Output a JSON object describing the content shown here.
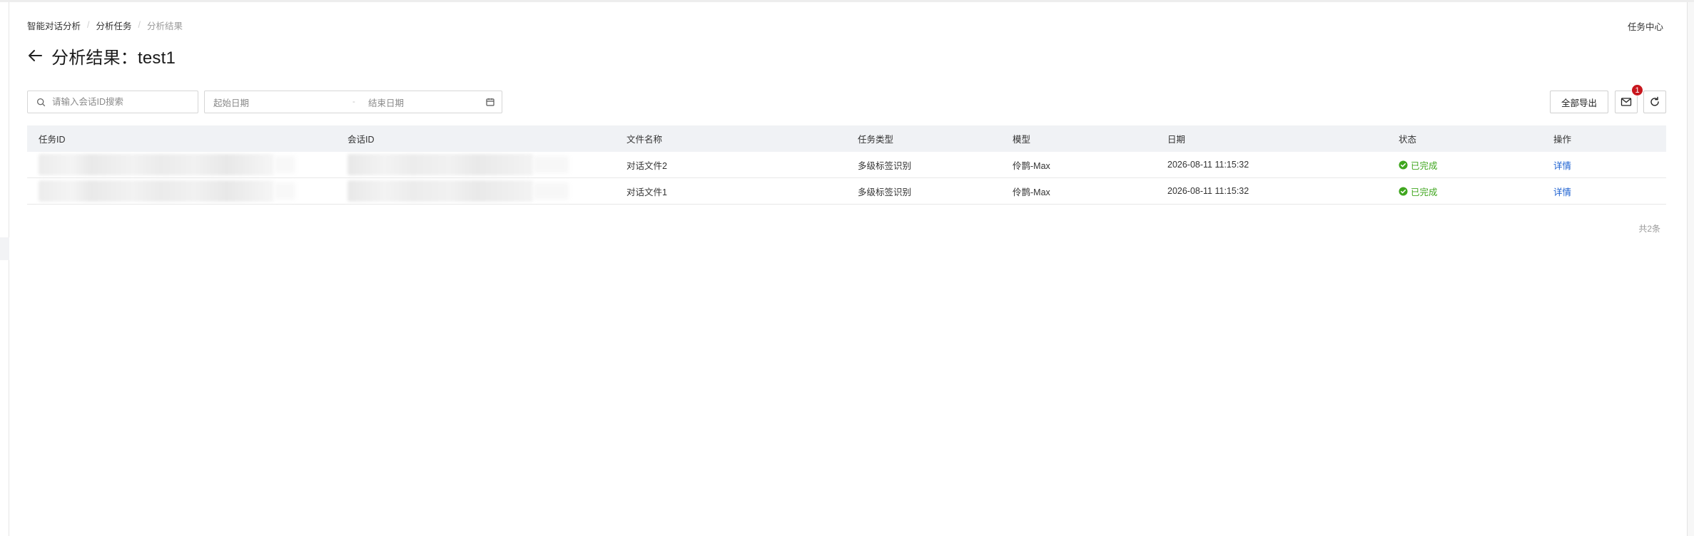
{
  "breadcrumb": {
    "items": [
      "智能对话分析",
      "分析任务",
      "分析结果"
    ]
  },
  "header": {
    "task_center": "任务中心",
    "title": "分析结果：test1"
  },
  "filters": {
    "search_placeholder": "请输入会话ID搜索",
    "start_date_placeholder": "起始日期",
    "end_date_placeholder": "结束日期",
    "range_separator": "-"
  },
  "toolbar": {
    "export_label": "全部导出",
    "mail_badge": "1"
  },
  "table": {
    "columns": [
      "任务ID",
      "会话ID",
      "文件名称",
      "任务类型",
      "模型",
      "日期",
      "状态",
      "操作"
    ],
    "rows": [
      {
        "task_id": "",
        "session_id": "",
        "file_name": "对话文件2",
        "task_type": "多级标签识别",
        "model": "伶鹊-Max",
        "date": "2026-08-11 11:15:32",
        "status": "已完成",
        "action": "详情"
      },
      {
        "task_id": "",
        "session_id": "",
        "file_name": "对话文件1",
        "task_type": "多级标签识别",
        "model": "伶鹊-Max",
        "date": "2026-08-11 11:15:32",
        "status": "已完成",
        "action": "详情"
      }
    ]
  },
  "pagination": {
    "total_text": "共2条"
  },
  "colors": {
    "status_success": "#3fa61e",
    "link": "#1a5fd0",
    "badge": "#c8171e",
    "header_bg": "#f0f2f5"
  },
  "icons": {
    "back": "arrow-left-icon",
    "search": "search-icon",
    "calendar": "calendar-icon",
    "mail": "mail-icon",
    "refresh": "refresh-icon",
    "status": "check-circle-icon"
  }
}
